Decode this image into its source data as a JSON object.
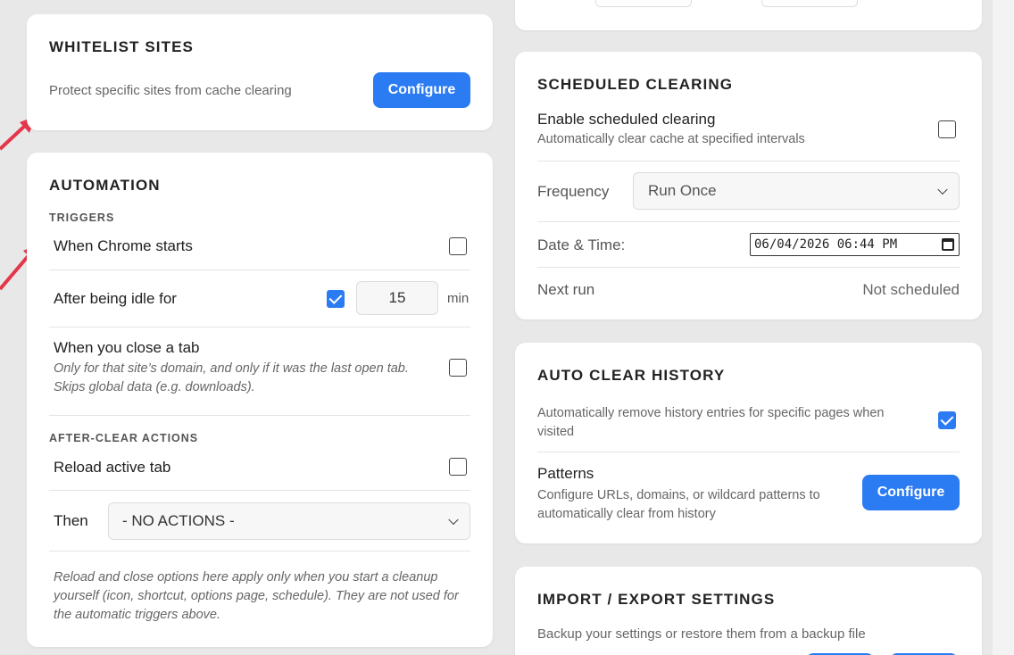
{
  "whitelist": {
    "title": "WHITELIST SITES",
    "description": "Protect specific sites from cache clearing",
    "button": "Configure"
  },
  "automation": {
    "title": "AUTOMATION",
    "triggers_label": "TRIGGERS",
    "chrome_starts": {
      "label": "When Chrome starts",
      "checked": false
    },
    "idle": {
      "label": "After being idle for",
      "checked": true,
      "value": "15",
      "unit": "min"
    },
    "close_tab": {
      "label": "When you close a tab",
      "note": "Only for that site’s domain, and only if it was the last open tab. Skips global data (e.g. downloads).",
      "checked": false
    },
    "after_clear_label": "AFTER-CLEAR ACTIONS",
    "reload": {
      "label": "Reload active tab",
      "checked": false
    },
    "then": {
      "label": "Then",
      "selected": "- NO ACTIONS -"
    },
    "footnote": "Reload and close options here apply only when you start a cleanup yourself (icon, shortcut, options page, schedule). They are not used for the automatic triggers above."
  },
  "scheduled": {
    "title": "SCHEDULED CLEARING",
    "enable": {
      "label": "Enable scheduled clearing",
      "sub": "Automatically clear cache at specified intervals",
      "checked": false
    },
    "frequency": {
      "label": "Frequency",
      "selected": "Run Once"
    },
    "datetime": {
      "label": "Date & Time:",
      "value": "06/04/2026 06:44 PM"
    },
    "next_run": {
      "label": "Next run",
      "value": "Not scheduled"
    }
  },
  "auto_history": {
    "title": "AUTO CLEAR HISTORY",
    "description": "Automatically remove history entries for specific pages when visited",
    "checked": true,
    "patterns": {
      "label": "Patterns",
      "sub": "Configure URLs, domains, or wildcard patterns to automatically clear from history",
      "button": "Configure"
    }
  },
  "import_export": {
    "title": "IMPORT / EXPORT SETTINGS",
    "description": "Backup your settings or restore them from a backup file"
  },
  "colors": {
    "accent": "#2b7bf3",
    "arrow": "#e5354a"
  }
}
